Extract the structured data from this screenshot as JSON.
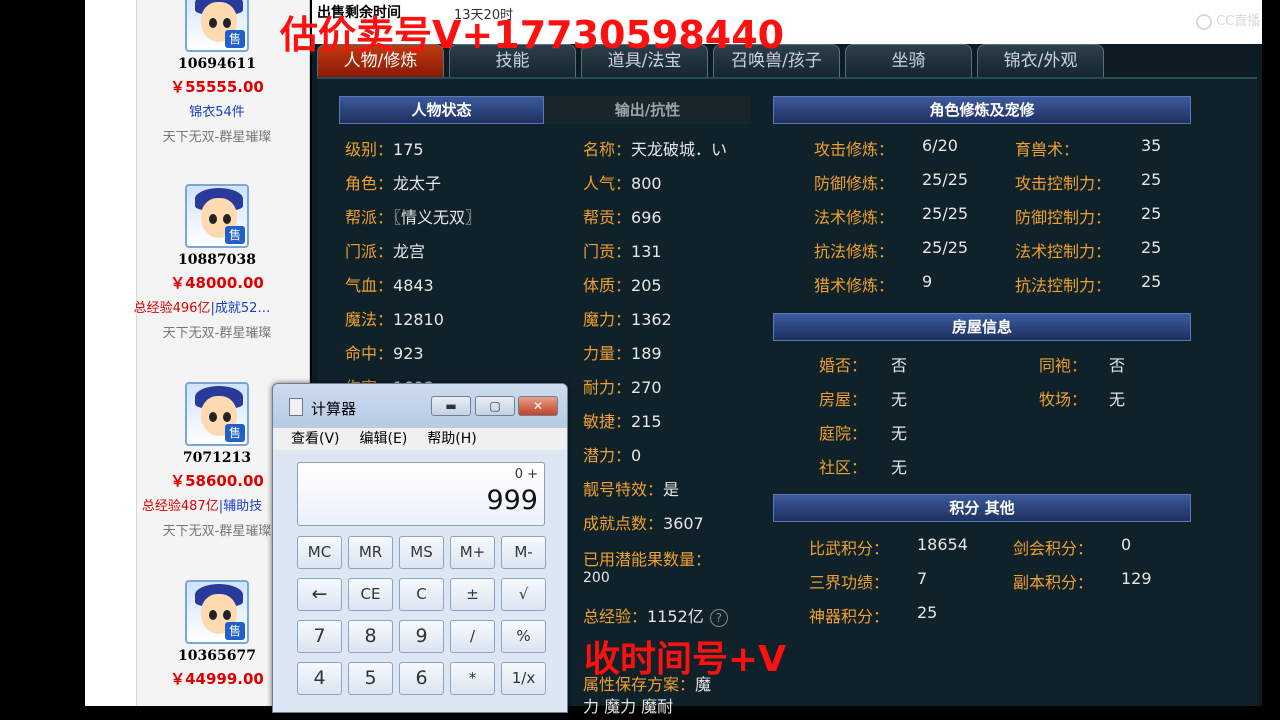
{
  "listings": [
    {
      "id": "10694611",
      "price": "￥55555.00",
      "note_parts": [
        {
          "text": "锦衣54件",
          "color": "blue"
        }
      ],
      "server": "天下无双-群星璀璨"
    },
    {
      "id": "10887038",
      "price": "￥48000.00",
      "note_parts": [
        {
          "text": "总经验496亿",
          "color": "red"
        },
        {
          "text": "|成就52…",
          "color": "blue"
        }
      ],
      "server": "天下无双-群星璀璨"
    },
    {
      "id": "7071213",
      "price": "￥58600.00",
      "note_parts": [
        {
          "text": "总经验487亿",
          "color": "red"
        },
        {
          "text": "|辅助技",
          "color": "blue"
        }
      ],
      "server": "天下无双-群星璀璨"
    },
    {
      "id": "10365677",
      "price": "￥44999.00",
      "note_parts": [],
      "server": ""
    }
  ],
  "sell_badge": "售",
  "header": {
    "remain_label": "出售剩余时间",
    "remain_value": "13天20时"
  },
  "tabs": [
    "人物/修炼",
    "技能",
    "道具/法宝",
    "召唤兽/孩子",
    "坐骑",
    "锦衣/外观"
  ],
  "status": {
    "title": "人物状态",
    "title2": "输出/抗性",
    "left": [
      {
        "k": "级别：",
        "v": "175"
      },
      {
        "k": "角色：",
        "v": "龙太子"
      },
      {
        "k": "帮派：",
        "v": "〖情义无双〗"
      },
      {
        "k": "门派：",
        "v": "龙宫"
      },
      {
        "k": "气血：",
        "v": "4843"
      },
      {
        "k": "魔法：",
        "v": "12810"
      },
      {
        "k": "命中：",
        "v": "923"
      },
      {
        "k": "伤害：",
        "v": "1608"
      }
    ],
    "right": [
      {
        "k": "名称：",
        "v": "天龙破城．い"
      },
      {
        "k": "人气：",
        "v": "800"
      },
      {
        "k": "帮贡：",
        "v": "696"
      },
      {
        "k": "门贡：",
        "v": "131"
      },
      {
        "k": "体质：",
        "v": "205"
      },
      {
        "k": "魔力：",
        "v": "1362"
      },
      {
        "k": "力量：",
        "v": "189"
      },
      {
        "k": "耐力：",
        "v": "270"
      },
      {
        "k": "敏捷：",
        "v": "215"
      },
      {
        "k": "潜力：",
        "v": "0"
      },
      {
        "k": "靓号特效：",
        "v": "是"
      },
      {
        "k": "成就点数：",
        "v": "3607"
      }
    ],
    "potion_label": "已用潜能果数量：",
    "potion_value": "200",
    "exp_label": "总经验：",
    "exp_value": "1152亿",
    "help": "?",
    "save_label": "属性保存方案：",
    "save_value": "魔",
    "save_value2": "力 魔力 魔耐"
  },
  "cultivation": {
    "title": "角色修炼及宠修",
    "left": [
      {
        "k": "攻击修炼：",
        "v": "6/20"
      },
      {
        "k": "防御修炼：",
        "v": "25/25"
      },
      {
        "k": "法术修炼：",
        "v": "25/25"
      },
      {
        "k": "抗法修炼：",
        "v": "25/25"
      },
      {
        "k": "猎术修炼：",
        "v": "9"
      }
    ],
    "right": [
      {
        "k": "育兽术：",
        "v": "35"
      },
      {
        "k": "攻击控制力：",
        "v": "25"
      },
      {
        "k": "防御控制力：",
        "v": "25"
      },
      {
        "k": "法术控制力：",
        "v": "25"
      },
      {
        "k": "抗法控制力：",
        "v": "25"
      }
    ]
  },
  "house": {
    "title": "房屋信息",
    "left": [
      {
        "k": "婚否：",
        "v": "否"
      },
      {
        "k": "房屋：",
        "v": "无"
      },
      {
        "k": "庭院：",
        "v": "无"
      },
      {
        "k": "社区：",
        "v": "无"
      }
    ],
    "right": [
      {
        "k": "同袍：",
        "v": "否"
      },
      {
        "k": "牧场：",
        "v": "无"
      }
    ]
  },
  "score": {
    "title": "积分 其他",
    "left": [
      {
        "k": "比武积分：",
        "v": "18654"
      },
      {
        "k": "三界功绩：",
        "v": "7"
      },
      {
        "k": "神器积分：",
        "v": "25"
      }
    ],
    "right": [
      {
        "k": "剑会积分：",
        "v": "0"
      },
      {
        "k": "副本积分：",
        "v": "129"
      }
    ]
  },
  "calculator": {
    "title": "计算器",
    "menu": [
      "查看(V)",
      "编辑(E)",
      "帮助(H)"
    ],
    "memory": "0 +",
    "display": "999",
    "keys": [
      "MC",
      "MR",
      "MS",
      "M+",
      "M-",
      "←",
      "CE",
      "C",
      "±",
      "√",
      "7",
      "8",
      "9",
      "/",
      "%",
      "4",
      "5",
      "6",
      "*",
      "1/x"
    ],
    "win_min": "▬",
    "win_max": "▢",
    "win_close": "✕"
  },
  "watermarks": {
    "top": "估价卖号V+17730598440",
    "bottom": "收时间号+V"
  },
  "brand": "CC直播"
}
